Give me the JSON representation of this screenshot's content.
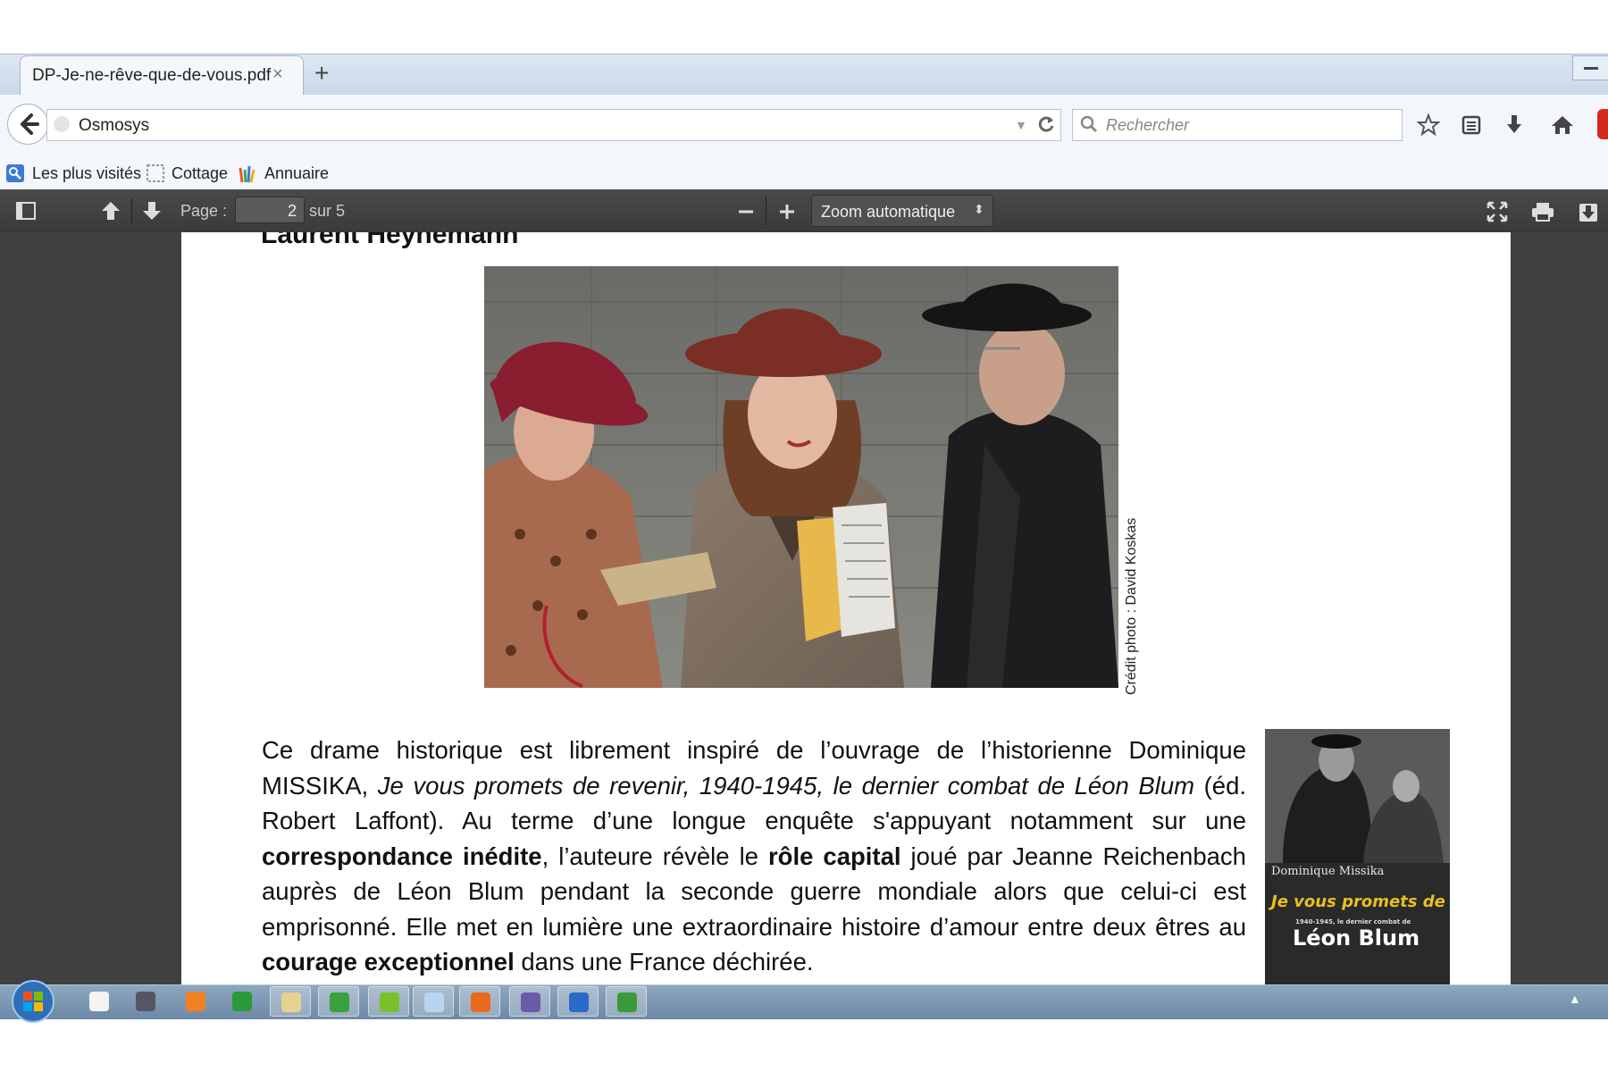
{
  "browser": {
    "tab_title": "DP-Je-ne-rêve-que-de-vous.pdf",
    "tab_close": "×",
    "new_tab": "+",
    "url": "Osmosys",
    "search_placeholder": "Rechercher",
    "bookmarks": [
      {
        "label": "Les plus visités",
        "icon": "most-visited-icon"
      },
      {
        "label": "Cottage",
        "icon": "folder-dashed-icon"
      },
      {
        "label": "Annuaire",
        "icon": "directory-icon"
      }
    ]
  },
  "pdf_toolbar": {
    "page_label": "Page :",
    "page_current": "2",
    "page_total": "sur 5",
    "zoom": "Zoom automatique"
  },
  "document": {
    "author_heading": "Laurent Heynemann",
    "photo_credit": "Crédit photo : David Koskas",
    "paragraph_parts": [
      {
        "text": "Ce drame historique est librement inspiré de l’ouvrage de l’historienne Dominique MISSIKA, ",
        "style": "normal"
      },
      {
        "text": "Je vous promets de revenir, 1940-1945, le dernier combat de Léon Blum",
        "style": "italic"
      },
      {
        "text": " (éd. Robert Laffont). Au terme d’une longue enquête s'appuyant notamment sur une ",
        "style": "normal"
      },
      {
        "text": "correspondance inédite",
        "style": "bold"
      },
      {
        "text": ", l’auteure révèle le ",
        "style": "normal"
      },
      {
        "text": "rôle capital",
        "style": "bold"
      },
      {
        "text": " joué par Jeanne Reichenbach auprès de Léon Blum pendant la seconde guerre mondiale alors que celui-ci est emprisonné. Elle met en lumière une extraordinaire histoire d’amour entre deux êtres au ",
        "style": "normal"
      },
      {
        "text": "courage exceptionnel",
        "style": "bold"
      },
      {
        "text": " dans une France déchirée.",
        "style": "normal"
      }
    ],
    "book_cover": {
      "author": "Dominique Missika",
      "title": "Je vous promets de revenir",
      "subtitle": "1940-1945, le dernier combat de",
      "name": "Léon Blum"
    }
  },
  "taskbar": {
    "apps": [
      "document-icon",
      "media-app-icon",
      "vlc-icon",
      "triangle-app-icon",
      "file-explorer-icon",
      "paint-icon",
      "image-app-icon",
      "notes-icon",
      "firefox-icon",
      "mail-app-icon",
      "writer-icon",
      "calc-icon"
    ]
  },
  "colors": {
    "toolbar_dark": "#3a3a3a",
    "viewer_bg": "#404040",
    "taskbar": "#7d97b2"
  }
}
